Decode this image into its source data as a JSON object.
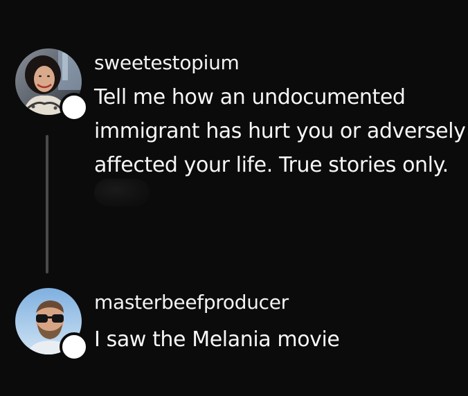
{
  "thread": {
    "posts": [
      {
        "username": "sweetestopium",
        "text": "Tell me how an undocumented\nimmigrant has hurt you or adversely\naffected your life. True stories only."
      },
      {
        "username": "masterbeefproducer",
        "text": "I saw the Melania movie"
      }
    ]
  },
  "colors": {
    "background": "#0b0b0b",
    "text": "#f7f7f7",
    "thread_line": "#4a4a4a",
    "status_dot": "#ffffff"
  }
}
